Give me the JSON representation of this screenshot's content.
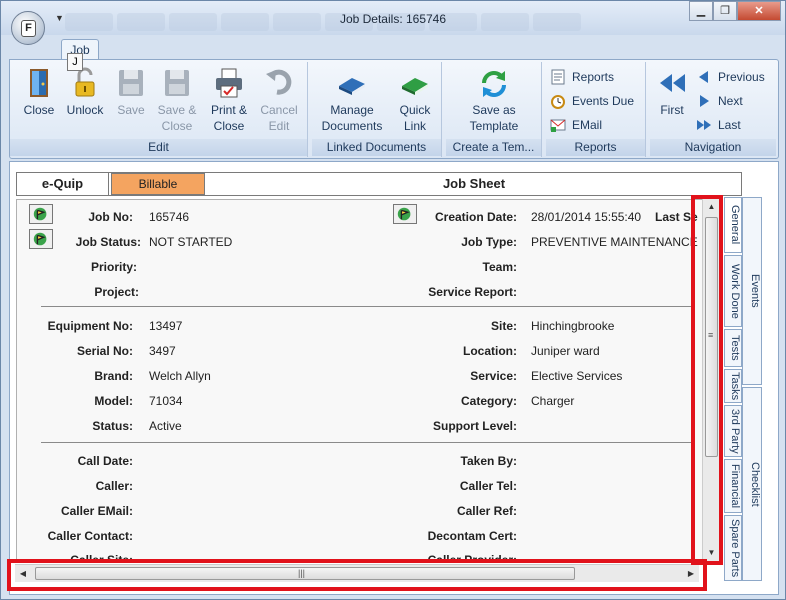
{
  "window": {
    "title": "Job Details: 165746",
    "app_icon_letter": "F",
    "controls": {
      "minimize": "▁",
      "restore": "❐",
      "close": "✕"
    }
  },
  "ribbon": {
    "tab": "Job",
    "keytip": "J",
    "groups": {
      "edit": {
        "label": "Edit",
        "close": "Close",
        "unlock": "Unlock",
        "save": "Save",
        "save_close_1": "Save &",
        "save_close_2": "Close",
        "print_close_1": "Print &",
        "print_close_2": "Close",
        "cancel_edit_1": "Cancel",
        "cancel_edit_2": "Edit"
      },
      "linked": {
        "label": "Linked Documents",
        "manage_1": "Manage",
        "manage_2": "Documents",
        "quick_1": "Quick",
        "quick_2": "Link"
      },
      "template": {
        "label": "Create  a  Tem...",
        "save_as_1": "Save as",
        "save_as_2": "Template"
      },
      "reports": {
        "label": "Reports",
        "reports": "Reports",
        "events_due": "Events Due",
        "email": "EMail"
      },
      "navigation": {
        "label": "Navigation",
        "first": "First",
        "previous": "Previous",
        "next": "Next",
        "last": "Last"
      }
    }
  },
  "header": {
    "equip": "e-Quip",
    "billable": "Billable",
    "sheet": "Job Sheet"
  },
  "form": {
    "job_no": {
      "label": "Job No:",
      "value": "165746"
    },
    "job_status": {
      "label": "Job Status:",
      "value": "NOT STARTED"
    },
    "priority": {
      "label": "Priority:",
      "value": ""
    },
    "project": {
      "label": "Project:",
      "value": ""
    },
    "creation_date": {
      "label": "Creation Date:",
      "value": "28/01/2014 15:55:40"
    },
    "last_se": {
      "label": "Last Se"
    },
    "job_type": {
      "label": "Job Type:",
      "value": "PREVENTIVE MAINTENANCE"
    },
    "team": {
      "label": "Team:",
      "value": ""
    },
    "service_report": {
      "label": "Service Report:",
      "value": ""
    },
    "equipment_no": {
      "label": "Equipment No:",
      "value": "13497"
    },
    "serial_no": {
      "label": "Serial No:",
      "value": "3497"
    },
    "brand": {
      "label": "Brand:",
      "value": "Welch Allyn"
    },
    "model": {
      "label": "Model:",
      "value": "71034"
    },
    "status": {
      "label": "Status:",
      "value": "Active"
    },
    "site": {
      "label": "Site:",
      "value": "Hinchingbrooke"
    },
    "location": {
      "label": "Location:",
      "value": "Juniper ward"
    },
    "service": {
      "label": "Service:",
      "value": "Elective Services"
    },
    "category": {
      "label": "Category:",
      "value": "Charger"
    },
    "support_level": {
      "label": "Support Level:",
      "value": ""
    },
    "call_date": {
      "label": "Call Date:"
    },
    "caller": {
      "label": "Caller:"
    },
    "caller_email": {
      "label": "Caller EMail:"
    },
    "caller_contact": {
      "label": "Caller Contact:"
    },
    "caller_site": {
      "label": "Caller Site:"
    },
    "taken_by": {
      "label": "Taken By:"
    },
    "caller_tel": {
      "label": "Caller Tel:"
    },
    "caller_ref": {
      "label": "Caller Ref:"
    },
    "decontam_cert": {
      "label": "Decontam Cert:"
    },
    "caller_provider": {
      "label": "Caller Provider:"
    }
  },
  "side_tabs": {
    "general": "General",
    "work_done": "Work Done",
    "tests": "Tests",
    "tasks": "Tasks",
    "third_party": "3rd Party",
    "financial": "Financial",
    "spare_parts": "Spare Parts",
    "events": "Events",
    "checklist": "Checklist"
  },
  "scrollbars": {
    "grip": "≡",
    "hgrip": "|||",
    "up": "▲",
    "down": "▼",
    "left": "◀",
    "right": "▶"
  },
  "colors": {
    "billable": "#f4a460",
    "highlight": "#e1121b"
  }
}
